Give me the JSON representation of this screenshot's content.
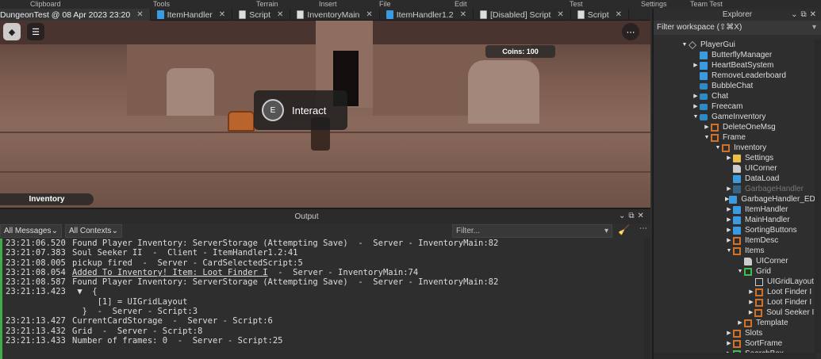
{
  "ribbon": [
    "Clipboard",
    "Tools",
    "Terrain",
    "Insert",
    "File",
    "Edit",
    "Test",
    "Settings",
    "Team Test"
  ],
  "tabs": [
    {
      "label": "DungeonTest @ 08 Apr 2023 23:20",
      "icon": "none"
    },
    {
      "label": "ItemHandler",
      "icon": "local-script-icon"
    },
    {
      "label": "Script",
      "icon": "script-icon"
    },
    {
      "label": "InventoryMain",
      "icon": "script-icon"
    },
    {
      "label": "ItemHandler1.2",
      "icon": "local-script-icon"
    },
    {
      "label": "[Disabled] Script",
      "icon": "script-icon"
    },
    {
      "label": "Script",
      "icon": "script-icon"
    }
  ],
  "viewport": {
    "coins": "Coins: 100",
    "interact_key": "E",
    "interact_label": "Interact",
    "inventory_label": "Inventory"
  },
  "output": {
    "title": "Output",
    "messages_filter": "All Messages",
    "contexts_filter": "All Contexts",
    "filter_placeholder": "Filter...",
    "lines": [
      {
        "ts": "23:21:06.520",
        "text": "Found Player Inventory: ServerStorage (Attempting Save)  -  Server - InventoryMain:82"
      },
      {
        "ts": "23:21:07.383",
        "text": "Soul Seeker II  -  Client - ItemHandler1.2:41"
      },
      {
        "ts": "23:21:08.005",
        "text": "pickup fired  -  Server - CardSelectedScript:5"
      },
      {
        "ts": "23:21:08.054",
        "text": "Added To Inventory! Item: Loot Finder I",
        "suffix": "  -  Server - InventoryMain:74"
      },
      {
        "ts": "23:21:08.587",
        "text": "Found Player Inventory: ServerStorage (Attempting Save)  -  Server - InventoryMain:82"
      },
      {
        "ts": "23:21:13.423",
        "text": " ▼  {"
      },
      {
        "ts": "",
        "text": "     [1] = UIGridLayout"
      },
      {
        "ts": "",
        "text": "  }  -  Server - Script:3"
      },
      {
        "ts": "23:21:13.427",
        "text": "CurrentCardStorage  -  Server - Script:6"
      },
      {
        "ts": "23:21:13.432",
        "text": "Grid  -  Server - Script:8"
      },
      {
        "ts": "23:21:13.433",
        "text": "Number of frames: 0  -  Server - Script:25"
      }
    ]
  },
  "explorer": {
    "title": "Explorer",
    "filter_placeholder": "Filter workspace (⇧⌘X)",
    "nodes": [
      {
        "label": "PlayerGui",
        "depth": 0,
        "arrow": "open",
        "icon": "pg"
      },
      {
        "label": "ButterflyManager",
        "depth": 1,
        "arrow": "",
        "icon": "script"
      },
      {
        "label": "HeartBeatSystem",
        "depth": 1,
        "arrow": "closed",
        "icon": "script"
      },
      {
        "label": "RemoveLeaderboard",
        "depth": 1,
        "arrow": "",
        "icon": "script"
      },
      {
        "label": "BubbleChat",
        "depth": 1,
        "arrow": "",
        "icon": "gui"
      },
      {
        "label": "Chat",
        "depth": 1,
        "arrow": "closed",
        "icon": "gui"
      },
      {
        "label": "Freecam",
        "depth": 1,
        "arrow": "closed",
        "icon": "gui"
      },
      {
        "label": "GameInventory",
        "depth": 1,
        "arrow": "open",
        "icon": "gui"
      },
      {
        "label": "DeleteOneMsg",
        "depth": 2,
        "arrow": "closed",
        "icon": "frame"
      },
      {
        "label": "Frame",
        "depth": 2,
        "arrow": "open",
        "icon": "frame"
      },
      {
        "label": "Inventory",
        "depth": 3,
        "arrow": "open",
        "icon": "frame"
      },
      {
        "label": "Settings",
        "depth": 4,
        "arrow": "closed",
        "icon": "folder"
      },
      {
        "label": "UICorner",
        "depth": 4,
        "arrow": "",
        "icon": "corner"
      },
      {
        "label": "DataLoad",
        "depth": 4,
        "arrow": "",
        "icon": "script"
      },
      {
        "label": "GarbageHandler",
        "depth": 4,
        "arrow": "closed",
        "icon": "script",
        "disabled": true
      },
      {
        "label": "GarbageHandler_EDI",
        "depth": 4,
        "arrow": "closed",
        "icon": "script"
      },
      {
        "label": "ItemHandler",
        "depth": 4,
        "arrow": "closed",
        "icon": "script"
      },
      {
        "label": "MainHandler",
        "depth": 4,
        "arrow": "closed",
        "icon": "script"
      },
      {
        "label": "SortingButtons",
        "depth": 4,
        "arrow": "closed",
        "icon": "script"
      },
      {
        "label": "ItemDesc",
        "depth": 4,
        "arrow": "closed",
        "icon": "frame"
      },
      {
        "label": "Items",
        "depth": 4,
        "arrow": "open",
        "icon": "frame"
      },
      {
        "label": "UICorner",
        "depth": 5,
        "arrow": "",
        "icon": "corner"
      },
      {
        "label": "Grid",
        "depth": 5,
        "arrow": "open",
        "icon": "grid"
      },
      {
        "label": "UIGridLayout",
        "depth": 6,
        "arrow": "",
        "icon": "layout"
      },
      {
        "label": "Loot Finder I",
        "depth": 6,
        "arrow": "closed",
        "icon": "frame"
      },
      {
        "label": "Loot Finder I",
        "depth": 6,
        "arrow": "closed",
        "icon": "frame"
      },
      {
        "label": "Soul Seeker II",
        "depth": 6,
        "arrow": "closed",
        "icon": "frame"
      },
      {
        "label": "Template",
        "depth": 5,
        "arrow": "closed",
        "icon": "frame"
      },
      {
        "label": "Slots",
        "depth": 4,
        "arrow": "closed",
        "icon": "frame"
      },
      {
        "label": "SortFrame",
        "depth": 4,
        "arrow": "closed",
        "icon": "frame"
      },
      {
        "label": "SearchBox",
        "depth": 4,
        "arrow": "closed",
        "icon": "box"
      }
    ]
  }
}
